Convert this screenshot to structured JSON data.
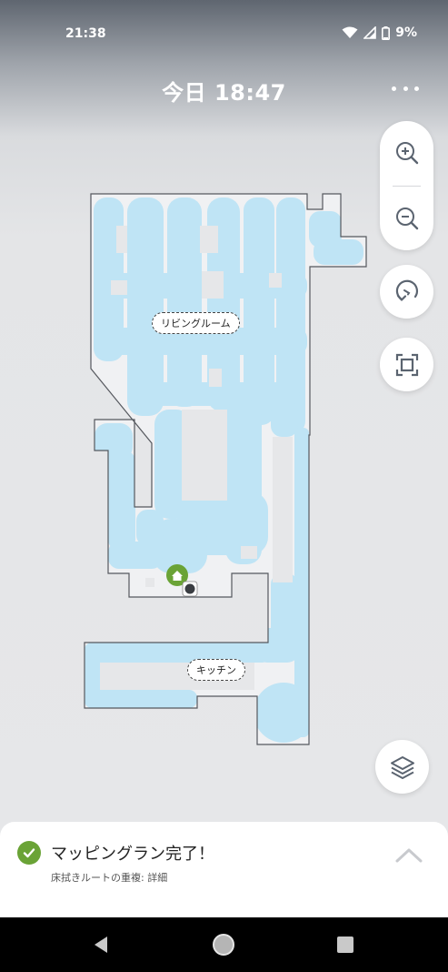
{
  "status_bar": {
    "time": "21:38",
    "battery": "9%"
  },
  "header": {
    "title": "今日 18:47"
  },
  "map": {
    "rooms": [
      {
        "label": "リビングルーム"
      },
      {
        "label": "キッチン"
      }
    ],
    "colors": {
      "floor": "#f0f1f3",
      "cleaned": "#bfe4f5",
      "wall": "#55585e",
      "dock": "#6aa336"
    }
  },
  "controls": {
    "zoom_in_icon": "zoom-in-icon",
    "zoom_out_icon": "zoom-out-icon",
    "rotate_icon": "rotate-icon",
    "fit_icon": "fit-screen-icon",
    "layers_icon": "layers-icon"
  },
  "bottom_sheet": {
    "title": "マッピングラン完了！",
    "subtitle": "床拭きルートの重複: 詳細"
  }
}
